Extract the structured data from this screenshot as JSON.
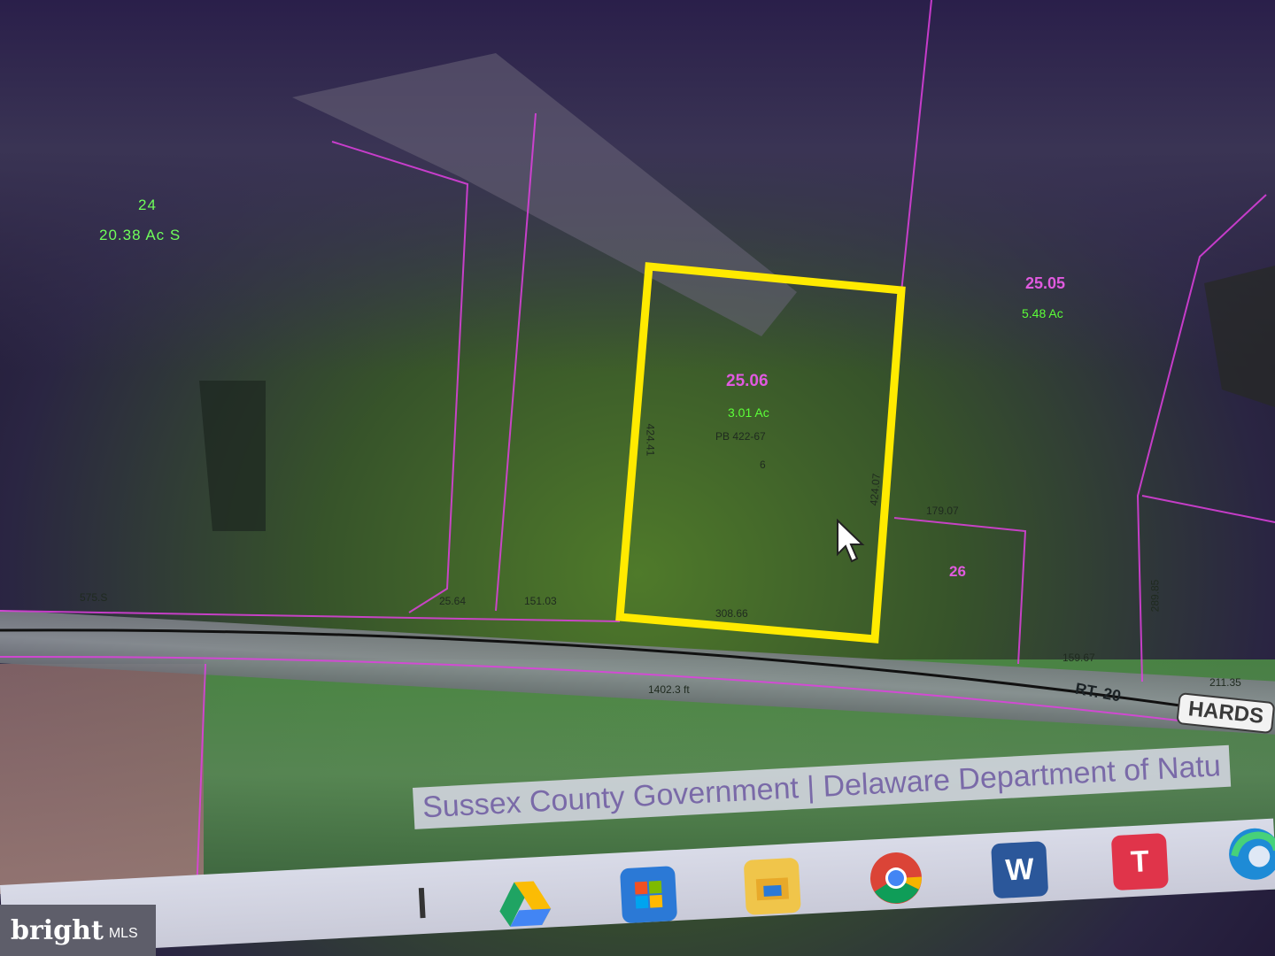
{
  "map": {
    "parcels": [
      {
        "id": "24",
        "acres": "20.38 Ac S"
      },
      {
        "id": "25.06",
        "acres": "3.01 Ac",
        "deed": "PB 422-67",
        "lot": "6",
        "selected": true
      },
      {
        "id": "25.05",
        "acres": "5.48 Ac"
      },
      {
        "id": "26"
      }
    ],
    "dimensions": [
      "575.S",
      "25.64",
      "151.03",
      "308.66",
      "424.41",
      "424.07",
      "179.07",
      "159.67",
      "1402.3 ft",
      "289.85",
      "211.35"
    ],
    "road_label": "RT. 20",
    "road_name_tag": "HARDS",
    "attribution": "Sussex County Government | Delaware Department of Natu",
    "colors": {
      "selected_outline": "#ffea00",
      "parcel_line": "#e040e0",
      "parcel_id": "#e05adf",
      "acres_text": "#5cff38"
    }
  },
  "taskbar": {
    "icons": [
      {
        "name": "google-drive-icon"
      },
      {
        "name": "microsoft-store-icon"
      },
      {
        "name": "file-explorer-icon"
      },
      {
        "name": "chrome-icon"
      },
      {
        "name": "word-icon",
        "label": "W"
      },
      {
        "name": "t-app-icon",
        "label": "T"
      },
      {
        "name": "edge-icon"
      }
    ]
  },
  "watermark": {
    "brand": "bright",
    "suffix": "MLS"
  }
}
